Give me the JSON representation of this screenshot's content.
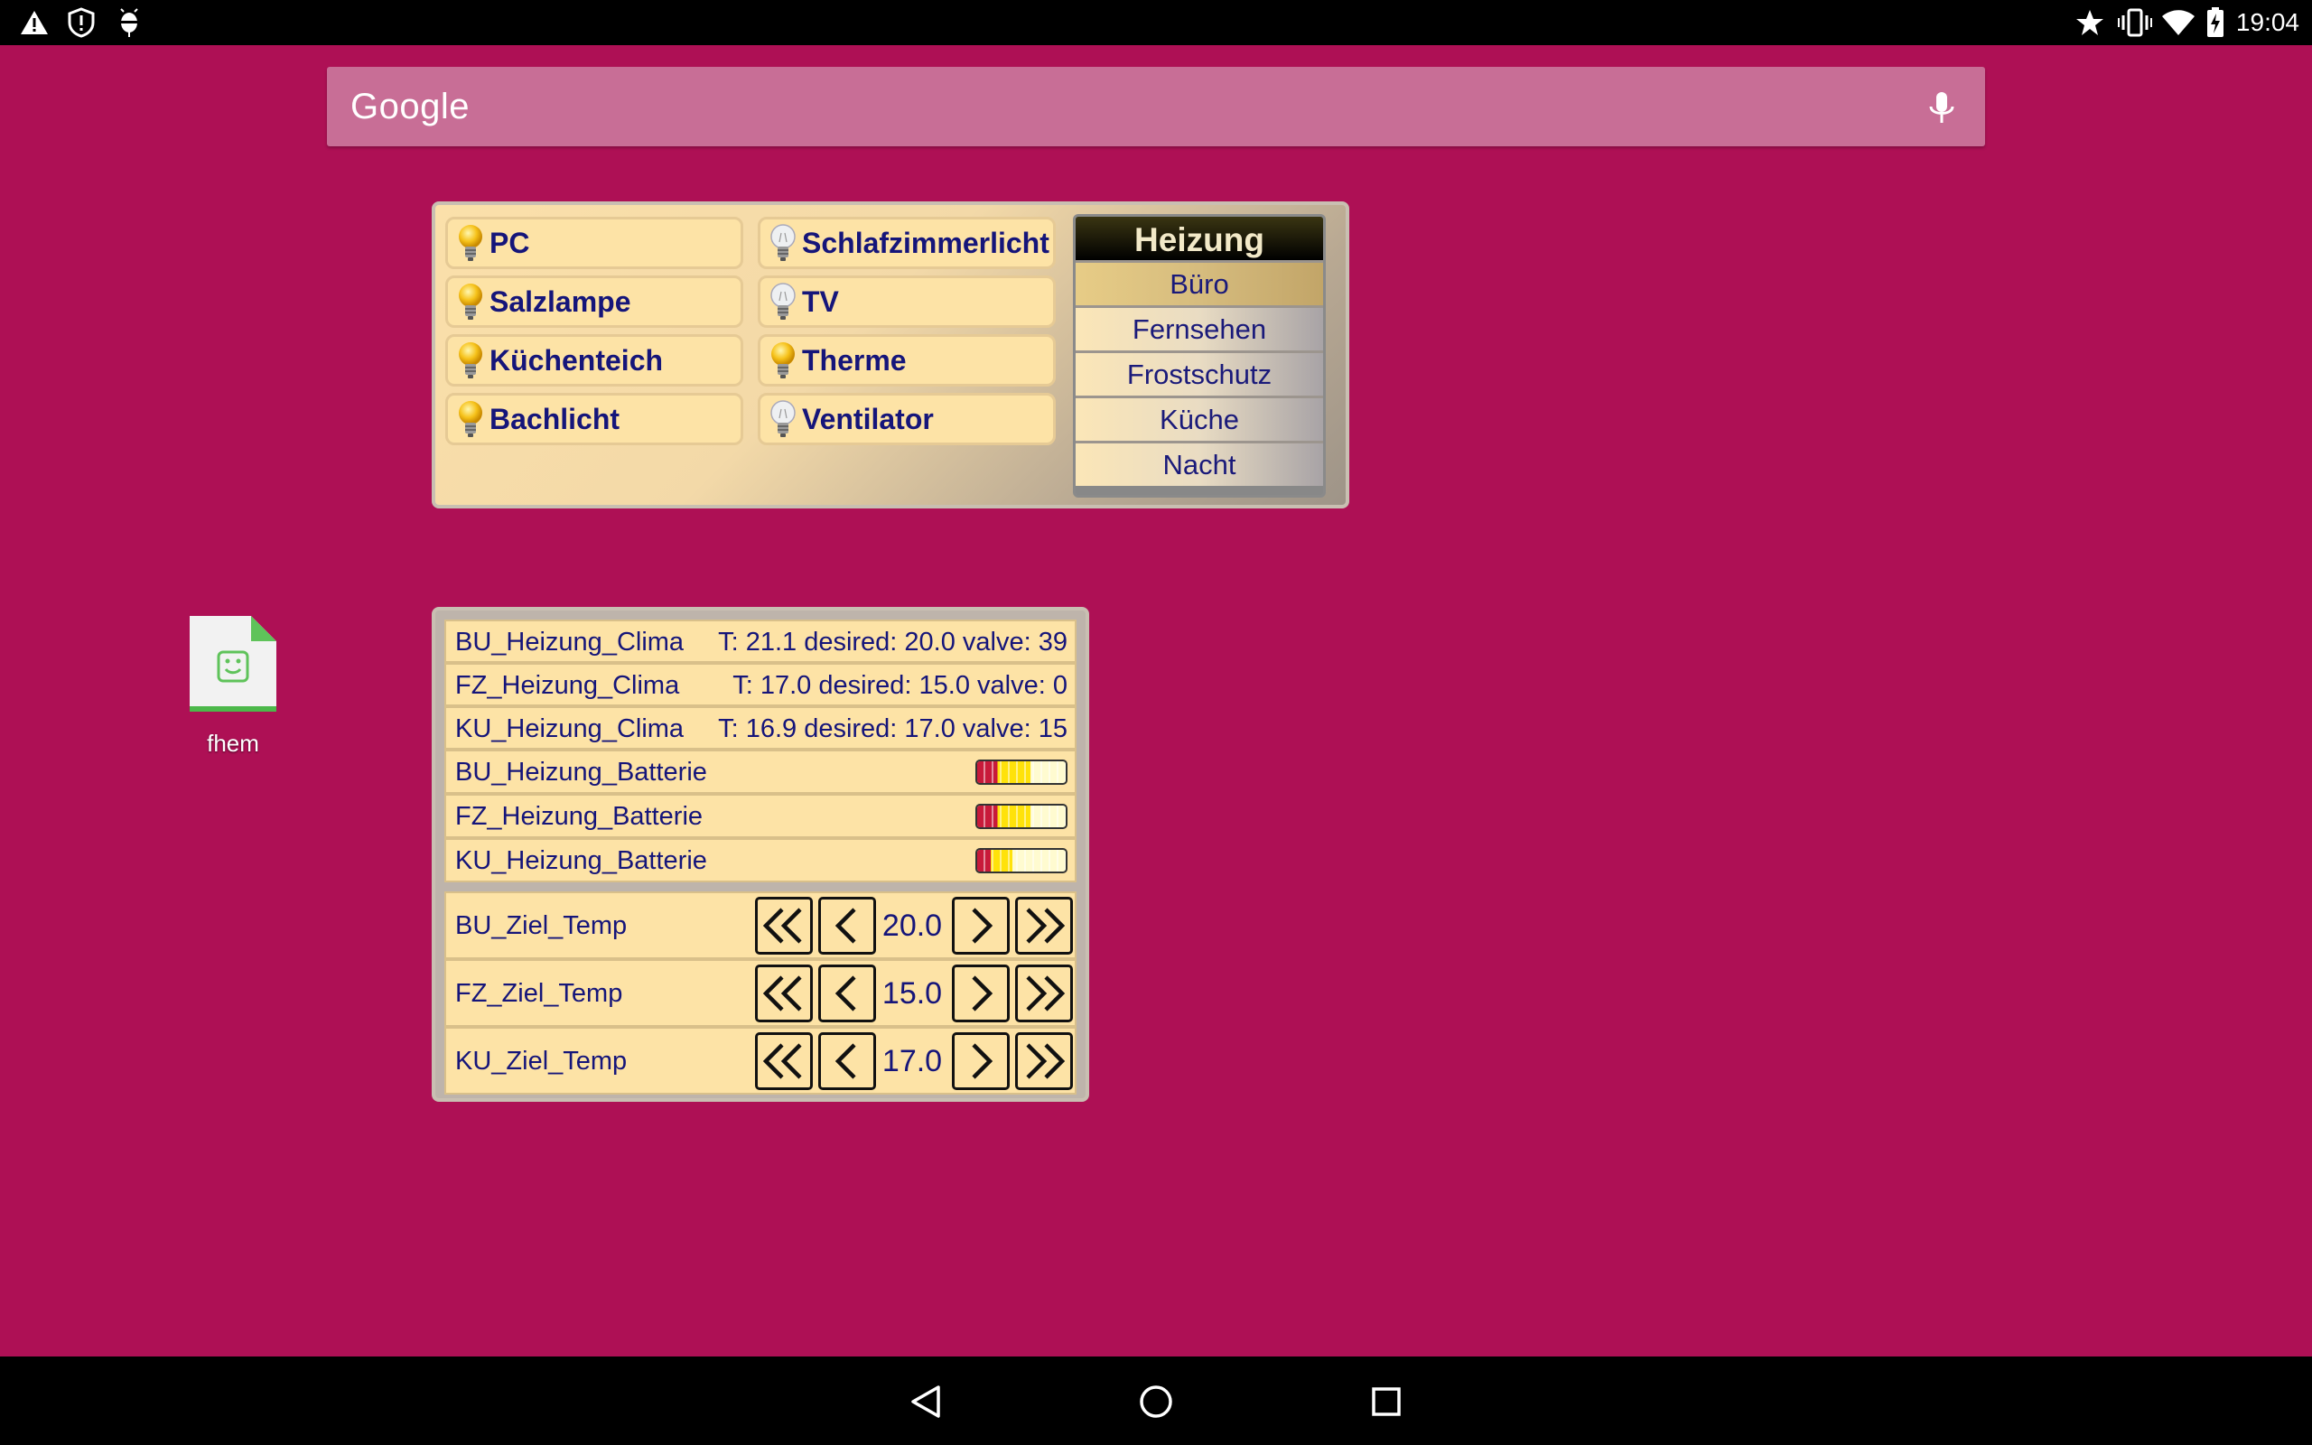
{
  "status_bar": {
    "time": "19:04",
    "left_icons": [
      "warning-icon",
      "shield-alert-icon",
      "android-debug-icon"
    ],
    "right_icons": [
      "star-icon",
      "vibrate-icon",
      "wifi-icon",
      "battery-charging-icon"
    ]
  },
  "search": {
    "logo": "Google",
    "icon": "mic-icon"
  },
  "lights_widget": {
    "buttons": [
      {
        "label": "PC",
        "state": "on"
      },
      {
        "label": "Schlafzimmerlicht",
        "state": "off"
      },
      {
        "label": "Salzlampe",
        "state": "on"
      },
      {
        "label": "TV",
        "state": "off"
      },
      {
        "label": "Küchenteich",
        "state": "on"
      },
      {
        "label": "Therme",
        "state": "on"
      },
      {
        "label": "Bachlicht",
        "state": "on"
      },
      {
        "label": "Ventilator",
        "state": "off"
      }
    ],
    "heizung": {
      "title": "Heizung",
      "items": [
        "Büro",
        "Fernsehen",
        "Frostschutz",
        "Küche",
        "Nacht"
      ],
      "selected": "Büro"
    }
  },
  "heating_widget": {
    "clima": [
      {
        "name": "BU_Heizung_Clima",
        "value": "T: 21.1 desired: 20.0 valve: 39"
      },
      {
        "name": "FZ_Heizung_Clima",
        "value": "T: 17.0 desired: 15.0 valve: 0"
      },
      {
        "name": "KU_Heizung_Clima",
        "value": "T: 16.9 desired: 17.0 valve: 15"
      }
    ],
    "battery": [
      {
        "name": "BU_Heizung_Batterie",
        "level": 0.6
      },
      {
        "name": "FZ_Heizung_Batterie",
        "level": 0.6
      },
      {
        "name": "KU_Heizung_Batterie",
        "level": 0.4
      }
    ],
    "targets": [
      {
        "name": "BU_Ziel_Temp",
        "value": "20.0"
      },
      {
        "name": "FZ_Ziel_Temp",
        "value": "15.0"
      },
      {
        "name": "KU_Ziel_Temp",
        "value": "17.0"
      }
    ]
  },
  "desktop_icon": {
    "label": "fhem"
  },
  "colors": {
    "wallpaper": "#ae1055",
    "widget_bg": "#fde3a6",
    "label_text": "#15157a"
  }
}
